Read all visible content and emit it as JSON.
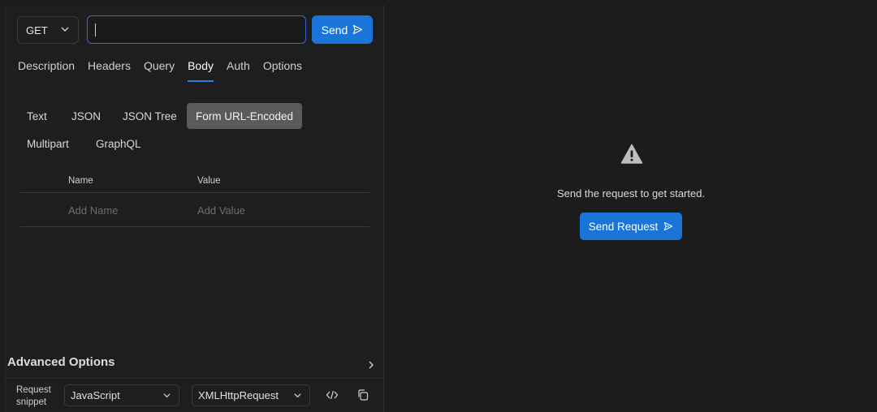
{
  "request": {
    "method": "GET",
    "url_value": "",
    "url_placeholder": "",
    "send_label": "Send"
  },
  "tabs": [
    {
      "label": "Description"
    },
    {
      "label": "Headers"
    },
    {
      "label": "Query"
    },
    {
      "label": "Body",
      "active": true
    },
    {
      "label": "Auth"
    },
    {
      "label": "Options"
    }
  ],
  "body_types": [
    {
      "label": "Text"
    },
    {
      "label": "JSON"
    },
    {
      "label": "JSON Tree"
    },
    {
      "label": "Form URL-Encoded",
      "active": true
    },
    {
      "label": "Multipart"
    },
    {
      "label": "GraphQL"
    }
  ],
  "form_table": {
    "col_name": "Name",
    "col_value": "Value",
    "placeholder_name": "Add Name",
    "placeholder_value": "Add Value"
  },
  "advanced": {
    "title": "Advanced Options",
    "snippet_label_1": "Request",
    "snippet_label_2": "snippet",
    "language": "JavaScript",
    "library": "XMLHttpRequest"
  },
  "response": {
    "empty_message": "Send the request to get started.",
    "send_request_label": "Send Request",
    "icon": "warning-icon"
  },
  "colors": {
    "accent": "#1b74d8",
    "active_tab_underline": "#2d7ee0",
    "active_body_type": "#5a5a5a"
  }
}
